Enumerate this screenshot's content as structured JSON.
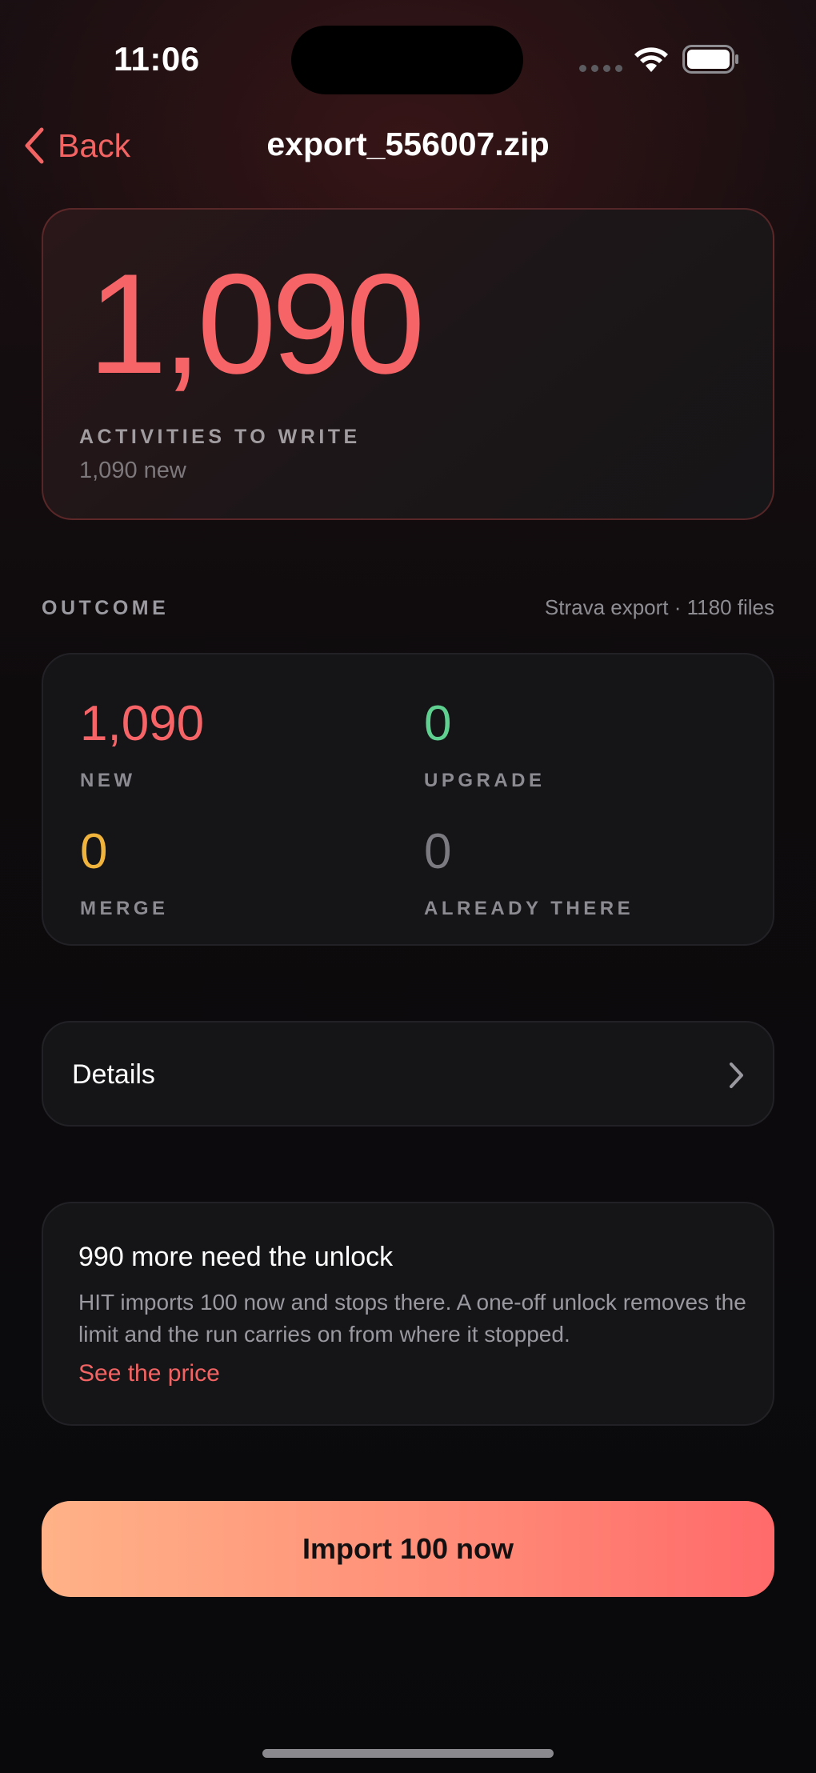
{
  "status_bar": {
    "time": "11:06"
  },
  "nav": {
    "back_label": "Back",
    "title": "export_556007.zip"
  },
  "hero": {
    "count": "1,090",
    "label": "ACTIVITIES TO WRITE",
    "sub": "1,090 new"
  },
  "outcome": {
    "header": "OUTCOME",
    "meta": "Strava export · 1180 files",
    "stats": [
      {
        "value": "1,090",
        "label": "NEW",
        "color": "#f66467"
      },
      {
        "value": "0",
        "label": "UPGRADE",
        "color": "#5fd08f"
      },
      {
        "value": "0",
        "label": "MERGE",
        "color": "#f0b33c"
      },
      {
        "value": "0",
        "label": "ALREADY THERE",
        "color": "#7a7a80"
      }
    ]
  },
  "details": {
    "label": "Details"
  },
  "unlock": {
    "title": "990 more need the unlock",
    "body": "HIT imports 100 now and stops there. A one-off unlock removes the limit and the run carries on from where it stopped.",
    "link": "See the price"
  },
  "cta": {
    "label": "Import 100 now"
  },
  "colors": {
    "accent": "#f26463",
    "background": "#0a0a0d",
    "card": "#151518"
  },
  "icons": [
    "chevron-left-icon",
    "chevron-right-icon",
    "wifi-icon",
    "battery-icon",
    "signal-icon"
  ]
}
